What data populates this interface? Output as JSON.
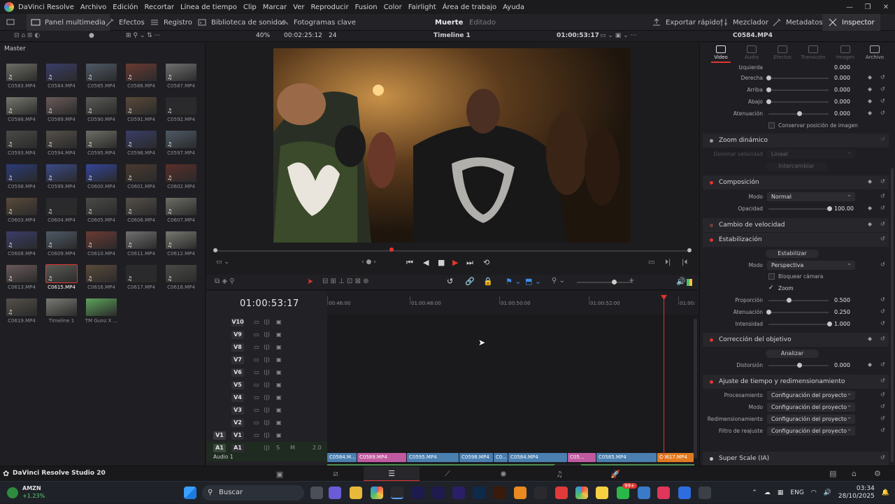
{
  "menubar": {
    "app_title": "DaVinci Resolve",
    "items": [
      "Archivo",
      "Edición",
      "Recortar",
      "Línea de tiempo",
      "Clip",
      "Marcar",
      "Ver",
      "Reproducir",
      "Fusion",
      "Color",
      "Fairlight",
      "Área de trabajo",
      "Ayuda"
    ]
  },
  "toolbar": {
    "left": [
      "Panel multimedia",
      "Efectos",
      "Registro",
      "Biblioteca de sonidos",
      "Fotogramas clave"
    ],
    "project_name": "Muerte",
    "project_status": "Editado",
    "right": [
      "Exportar rápido",
      "Mezclador",
      "Metadatos",
      "Inspector"
    ]
  },
  "viewer_bar": {
    "zoom": "40%",
    "source_timecode": "00:02:25:12",
    "fps": "24",
    "timeline_name": "Timeline 1",
    "record_timecode": "01:00:53:17",
    "clip_name": "C0584.MP4"
  },
  "media_pool": {
    "label": "Master",
    "clips": [
      "C0583.MP4",
      "C0584.MP4",
      "C0585.MP4",
      "C0586.MP4",
      "C0587.MP4",
      "C0588.MP4",
      "C0589.MP4",
      "C0590.MP4",
      "C0591.MP4",
      "C0592.MP4",
      "C0593.MP4",
      "C0594.MP4",
      "C0595.MP4",
      "C0596.MP4",
      "C0597.MP4",
      "C0598.MP4",
      "C0599.MP4",
      "C0600.MP4",
      "C0601.MP4",
      "C0602.MP4",
      "C0603.MP4",
      "C0604.MP4",
      "C0605.MP4",
      "C0606.MP4",
      "C0607.MP4",
      "C0608.MP4",
      "C0609.MP4",
      "C0610.MP4",
      "C0611.MP4",
      "C0612.MP4",
      "C0613.MP4",
      "C0615.MP4",
      "C0616.MP4",
      "C0617.MP4",
      "C0618.MP4",
      "C0619.MP4",
      "Timeline 1",
      "TM Gunz X ..."
    ],
    "selected": "C0615.MP4"
  },
  "timeline": {
    "timecode": "01:00:53:17",
    "ruler": [
      "00:46:00",
      "01:00:48:00",
      "01:00:50:00",
      "01:00:52:00",
      "01:00:"
    ],
    "video_tracks": [
      "V10",
      "V9",
      "V8",
      "V7",
      "V6",
      "V5",
      "V4",
      "V3",
      "V2",
      "V1"
    ],
    "audio_track": "A1",
    "audio_name": "Audio 1",
    "audio_level": "2.0",
    "v1_clips": [
      "C0584.M...",
      "C0589.MP4",
      "C0595.MP4",
      "C0598.MP4",
      "C0...",
      "C0584.MP4",
      "C05...",
      "C0585.MP4",
      "C0617.MP4"
    ]
  },
  "inspector": {
    "tabs": [
      "Video",
      "Audio",
      "Efectos",
      "Transición",
      "Imagen",
      "Archivo"
    ],
    "crop": [
      {
        "label": "Izquierda",
        "value": "0.000"
      },
      {
        "label": "Derecha",
        "value": "0.000"
      },
      {
        "label": "Arriba",
        "value": "0.000"
      },
      {
        "label": "Abajo",
        "value": "0.000"
      },
      {
        "label": "Atenuación",
        "value": "0.000"
      }
    ],
    "retain_label": "Conservar posición de imagen",
    "zoom_dyn": {
      "title": "Zoom dinámico",
      "speed_label": "Dominar velocidad",
      "speed_value": "Lineal",
      "swap_label": "Intercambiar"
    },
    "composition": {
      "title": "Composición",
      "mode_label": "Modo",
      "mode_value": "Normal",
      "opacity_label": "Opacidad",
      "opacity_value": "100.00"
    },
    "speed_change": {
      "title": "Cambio de velocidad"
    },
    "stabilization": {
      "title": "Estabilización",
      "button": "Estabilizar",
      "mode_label": "Modo",
      "mode_value": "Perspectiva",
      "lock_label": "Bloquear cámara",
      "zoom_label": "Zoom",
      "params": [
        {
          "label": "Proporción",
          "value": "0.500"
        },
        {
          "label": "Atenuación",
          "value": "0.250"
        },
        {
          "label": "Intensidad",
          "value": "1.000"
        }
      ]
    },
    "lens": {
      "title": "Corrección del objetivo",
      "button": "Analizar",
      "dist_label": "Distorsión",
      "dist_value": "0.000"
    },
    "retime": {
      "title": "Ajuste de tiempo y redimensionamiento",
      "rows": [
        {
          "label": "Procesamiento",
          "value": "Configuración del proyecto"
        },
        {
          "label": "Modo",
          "value": "Configuración del proyecto"
        },
        {
          "label": "Redimensionamiento",
          "value": "Configuración del proyecto"
        },
        {
          "label": "Filtro de reajuste",
          "value": "Configuración del proyecto"
        }
      ]
    },
    "superscale": {
      "title": "Super Scale (IA)"
    }
  },
  "bottom": {
    "brand": "DaVinci Resolve Studio 20"
  },
  "taskbar": {
    "stock": "AMZN",
    "stock_change": "+1.23%",
    "search": "Buscar",
    "lang": "ENG",
    "time": "03:34",
    "date": "28/10/2025",
    "badge": "99+"
  }
}
